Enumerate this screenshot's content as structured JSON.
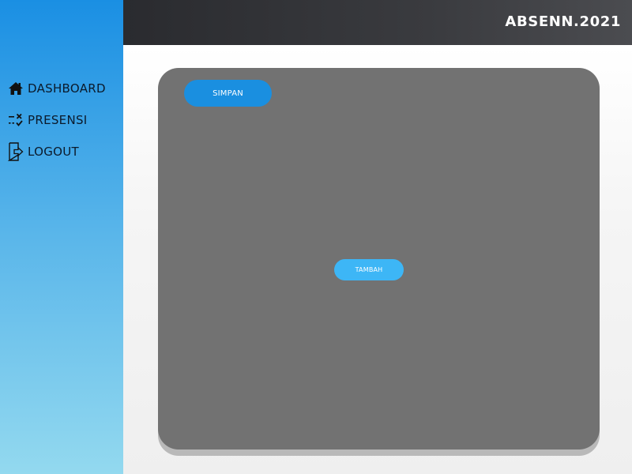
{
  "brand": "ABSENN.2021",
  "sidebar": {
    "items": [
      {
        "label": "DASHBOARD",
        "icon": "home-icon"
      },
      {
        "label": "PRESENSI",
        "icon": "checklist-icon"
      },
      {
        "label": "LOGOUT",
        "icon": "logout-icon"
      }
    ]
  },
  "main": {
    "save_label": "SIMPAN",
    "add_label": "TAMBAH"
  },
  "colors": {
    "sidebar_top": "#1a8fe3",
    "sidebar_bottom": "#93d9ef",
    "header": "#2a2b2f",
    "panel": "#727272",
    "save_button": "#1a8fe0",
    "add_button": "#3db6f6"
  }
}
